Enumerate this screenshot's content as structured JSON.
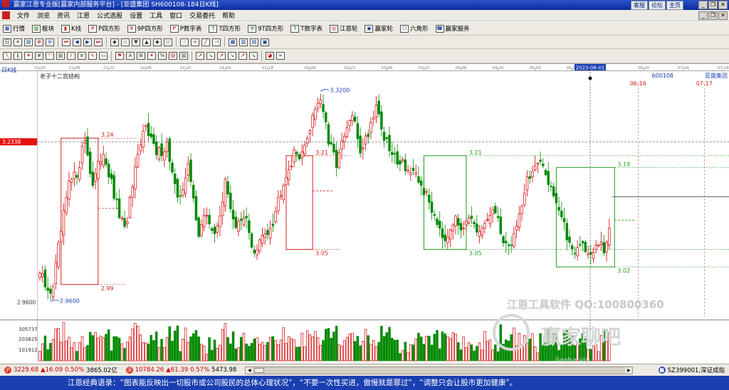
{
  "window": {
    "title": "赢家江恩专业版[赢家内部服务平台] - [亚盛集团  SH600108-184日K线]",
    "links": [
      "客服",
      "论坛",
      "主页"
    ]
  },
  "menu": [
    "文件",
    "浏览",
    "资讯",
    "江恩",
    "公式选股",
    "设置",
    "工具",
    "窗口",
    "交易委托",
    "帮助"
  ],
  "toolbar1": [
    {
      "label": "行情",
      "icon": "grid-icon"
    },
    {
      "label": "板块",
      "icon": "blocks-icon"
    },
    {
      "label": "K线",
      "icon": "candle-icon"
    },
    {
      "label": "P四方形",
      "icon": "square-icon"
    },
    {
      "label": "9P四方形",
      "icon": "square-icon"
    },
    {
      "label": "P数字表",
      "icon": "table-icon"
    },
    {
      "label": "T四方形",
      "icon": "square-icon"
    },
    {
      "label": "9T四方形",
      "icon": "square-icon"
    },
    {
      "label": "T数字表",
      "icon": "table-icon"
    },
    {
      "label": "江恩轮",
      "icon": "wheel-icon"
    },
    {
      "label": "赢家轮",
      "icon": "wheel-icon"
    },
    {
      "label": "六角形",
      "icon": "hexagon-icon"
    },
    {
      "label": "赢家服务",
      "icon": "service-icon"
    }
  ],
  "chart_data": {
    "type": "candlestick",
    "period_label": "日K线",
    "title": "老子十二宫结构",
    "stock_code": "600108",
    "stock_name": "亚盛集团",
    "current_price_label": "3.2338",
    "selected_date": "2023-06-01",
    "ylim": [
      2.935,
      3.335
    ],
    "date_ticks": [
      {
        "i": 0,
        "label": "10-25"
      },
      {
        "i": 13,
        "label": "11-08"
      },
      {
        "i": 26,
        "label": "11-22"
      },
      {
        "i": 40,
        "label": "12-06"
      },
      {
        "i": 55,
        "label": "12-20"
      },
      {
        "i": 70,
        "label": "01-04"
      },
      {
        "i": 86,
        "label": "01-18"
      },
      {
        "i": 102,
        "label": "02-08"
      },
      {
        "i": 117,
        "label": "02-22"
      },
      {
        "i": 131,
        "label": "03-08"
      },
      {
        "i": 145,
        "label": "03-22"
      },
      {
        "i": 159,
        "label": "04-06"
      },
      {
        "i": 173,
        "label": "04-20"
      },
      {
        "i": 187,
        "label": "05-09"
      },
      {
        "i": 201,
        "label": "05-23"
      },
      {
        "i": 228,
        "label": "06-20"
      },
      {
        "i": 243,
        "label": "07-04"
      },
      {
        "i": 258,
        "label": "07-18"
      }
    ],
    "anchors": [
      [
        0,
        3.01
      ],
      [
        4,
        2.962
      ],
      [
        8,
        3.08
      ],
      [
        11,
        3.16
      ],
      [
        14,
        3.18
      ],
      [
        17,
        3.24
      ],
      [
        20,
        3.16
      ],
      [
        24,
        3.22
      ],
      [
        28,
        3.14
      ],
      [
        32,
        3.08
      ],
      [
        36,
        3.18
      ],
      [
        40,
        3.27
      ],
      [
        44,
        3.21
      ],
      [
        48,
        3.23
      ],
      [
        52,
        3.13
      ],
      [
        56,
        3.19
      ],
      [
        60,
        3.08
      ],
      [
        63,
        3.11
      ],
      [
        66,
        3.07
      ],
      [
        70,
        3.16
      ],
      [
        74,
        3.09
      ],
      [
        78,
        3.1
      ],
      [
        81,
        3.04
      ],
      [
        84,
        3.07
      ],
      [
        88,
        3.1
      ],
      [
        92,
        3.17
      ],
      [
        96,
        3.21
      ],
      [
        100,
        3.22
      ],
      [
        103,
        3.28
      ],
      [
        106,
        3.318
      ],
      [
        109,
        3.23
      ],
      [
        112,
        3.2
      ],
      [
        115,
        3.24
      ],
      [
        118,
        3.28
      ],
      [
        121,
        3.22
      ],
      [
        124,
        3.25
      ],
      [
        127,
        3.3
      ],
      [
        130,
        3.24
      ],
      [
        133,
        3.21
      ],
      [
        137,
        3.2
      ],
      [
        140,
        3.18
      ],
      [
        144,
        3.16
      ],
      [
        147,
        3.13
      ],
      [
        150,
        3.1
      ],
      [
        153,
        3.07
      ],
      [
        156,
        3.1
      ],
      [
        159,
        3.09
      ],
      [
        162,
        3.11
      ],
      [
        165,
        3.07
      ],
      [
        168,
        3.09
      ],
      [
        171,
        3.12
      ],
      [
        174,
        3.08
      ],
      [
        177,
        3.05
      ],
      [
        180,
        3.09
      ],
      [
        184,
        3.17
      ],
      [
        187,
        3.19
      ],
      [
        190,
        3.19
      ],
      [
        193,
        3.16
      ],
      [
        196,
        3.12
      ],
      [
        199,
        3.07
      ],
      [
        202,
        3.05
      ],
      [
        205,
        3.06
      ],
      [
        208,
        3.035
      ],
      [
        211,
        3.06
      ],
      [
        213,
        3.045
      ],
      [
        215,
        3.08
      ]
    ],
    "volume_ticks": [
      305737,
      203825,
      101912
    ],
    "extra_date_labels": [
      {
        "i": 226,
        "label": "06-16",
        "color": "red"
      },
      {
        "i": 251,
        "label": "07-17",
        "color": "red"
      }
    ],
    "gann_boxes": [
      {
        "from_i": 8,
        "to_i": 22,
        "high": 3.24,
        "low": 2.99,
        "color": "red",
        "labels": {
          "high": "3.24",
          "low": "2.99"
        },
        "mid_level": 3.12
      },
      {
        "from_i": 93,
        "to_i": 103,
        "high": 3.21,
        "low": 3.05,
        "color": "red",
        "labels": {
          "high": "3.21",
          "low": "3.05"
        },
        "mid_level": 3.15
      },
      {
        "from_i": 145,
        "to_i": 161,
        "high": 3.21,
        "low": 3.05,
        "color": "green",
        "labels": {
          "high": "3.21",
          "low": "3.05"
        },
        "mid_level": 3.09
      },
      {
        "from_i": 195,
        "to_i": 217,
        "high": 3.19,
        "low": 3.02,
        "color": "green",
        "labels": {
          "high": "3.19",
          "low": "3.02"
        },
        "mid_level": 3.1
      }
    ],
    "extremes": [
      {
        "i": 4,
        "value": 2.96,
        "label": "2.9600"
      },
      {
        "i": 106,
        "value": 3.32,
        "label": "3.3200"
      }
    ],
    "y_label": "2.9600"
  },
  "watermark": {
    "line1": "江恩工具软件  QQ:100800360",
    "line2": "赢家聊吧",
    "line3": "liaoba.vip"
  },
  "status": {
    "sh_index": "3229.68",
    "sh_change": "▲16.09",
    "sh_pct": "0.50%",
    "sh_amount": "3865.02亿",
    "sz_index": "10784.26",
    "sz_change": "▲61.39",
    "sz_pct": "0.57%",
    "sz_amount": "5473.98",
    "right_text": "SZ399001,深证成指"
  },
  "ticker": "江恩经典语录：“图表能反映出一切股市或公司股民的总体心理状况”，“不要一次性买进，傲慢就是罪过”，“调整只会让股市更加健康”。",
  "colors": {
    "up": "#d40000",
    "down": "#008a00",
    "box_red": "#d42020",
    "box_green": "#229a22",
    "price_tag": "#e81010"
  }
}
